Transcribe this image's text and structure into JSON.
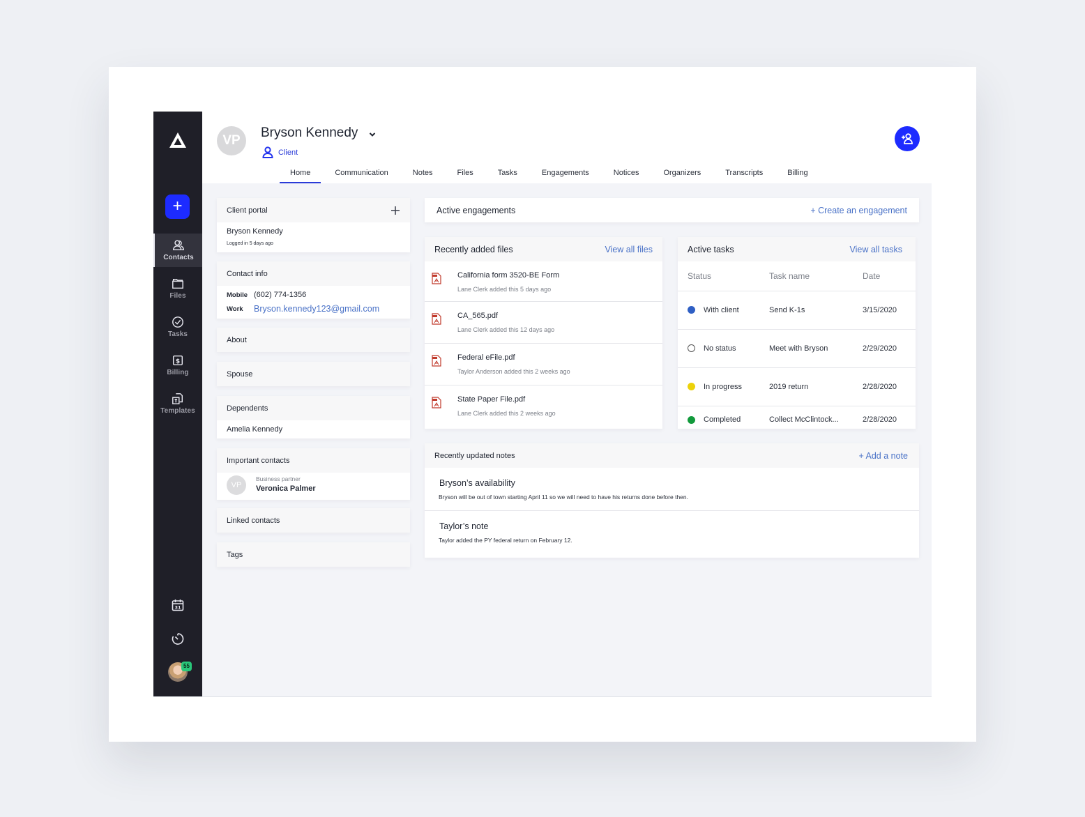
{
  "sidebar": {
    "new_button": "+",
    "items": [
      {
        "label": "Contacts",
        "icon": "contacts-icon",
        "active": true
      },
      {
        "label": "Files",
        "icon": "folder-icon",
        "active": false
      },
      {
        "label": "Tasks",
        "icon": "check-circle-icon",
        "active": false
      },
      {
        "label": "Billing",
        "icon": "dollar-icon",
        "active": false
      },
      {
        "label": "Templates",
        "icon": "templates-icon",
        "active": false
      }
    ],
    "calendar_day": "31",
    "notification_count": "55"
  },
  "header": {
    "avatar_initials": "VP",
    "contact_name": "Bryson Kennedy",
    "contact_type": "Client",
    "tabs": [
      "Home",
      "Communication",
      "Notes",
      "Files",
      "Tasks",
      "Engagements",
      "Notices",
      "Organizers",
      "Transcripts",
      "Billing"
    ],
    "active_tab": "Home"
  },
  "left": {
    "client_portal": {
      "title": "Client portal",
      "name": "Bryson Kennedy",
      "status": "Logged in 5 days ago"
    },
    "contact_info": {
      "title": "Contact info",
      "mobile_label": "Mobile",
      "mobile": "(602) 774-1356",
      "work_label": "Work",
      "work": "Bryson.kennedy123@gmail.com"
    },
    "about": {
      "title": "About"
    },
    "spouse": {
      "title": "Spouse"
    },
    "dependents": {
      "title": "Dependents",
      "items": [
        "Amelia Kennedy"
      ]
    },
    "important_contacts": {
      "title": "Important contacts",
      "initials": "VP",
      "role": "Business partner",
      "name": "Veronica Palmer"
    },
    "linked_contacts": {
      "title": "Linked contacts"
    },
    "tags": {
      "title": "Tags"
    }
  },
  "engagements": {
    "title": "Active engagements",
    "action": "+ Create an engagement"
  },
  "files": {
    "title": "Recently added files",
    "action": "View all files",
    "items": [
      {
        "name": "California form 3520-BE Form",
        "meta": "Lane Clerk added this 5 days ago"
      },
      {
        "name": "CA_565.pdf",
        "meta": "Lane Clerk added this 12 days ago"
      },
      {
        "name": "Federal eFile.pdf",
        "meta": "Taylor Anderson added this 2 weeks ago"
      },
      {
        "name": "State Paper File.pdf",
        "meta": "Lane Clerk added this 2 weeks ago"
      }
    ]
  },
  "tasks": {
    "title": "Active tasks",
    "action": "View all tasks",
    "columns": [
      "Status",
      "Task name",
      "Date"
    ],
    "rows": [
      {
        "status": "With client",
        "color": "#2f5fc4",
        "name": "Send K-1s",
        "date": "3/15/2020"
      },
      {
        "status": "No status",
        "color": "",
        "name": "Meet with Bryson",
        "date": "2/29/2020"
      },
      {
        "status": "In progress",
        "color": "#ecd20a",
        "name": "2019 return",
        "date": "2/28/2020"
      },
      {
        "status": "Completed",
        "color": "#129a3c",
        "name": "Collect McClintock...",
        "date": "2/28/2020"
      }
    ]
  },
  "notes": {
    "title": "Recently updated notes",
    "action": "+ Add a note",
    "items": [
      {
        "title": "Bryson’s availability",
        "body": "Bryson will be out of town starting April 11 so we will need to have his returns done before then."
      },
      {
        "title": "Taylor’s note",
        "body": "Taylor added the PY federal return on February 12."
      }
    ]
  },
  "colors": {
    "accent": "#1d2bff",
    "link": "#4a72c7",
    "sidebar": "#1f1f28"
  }
}
